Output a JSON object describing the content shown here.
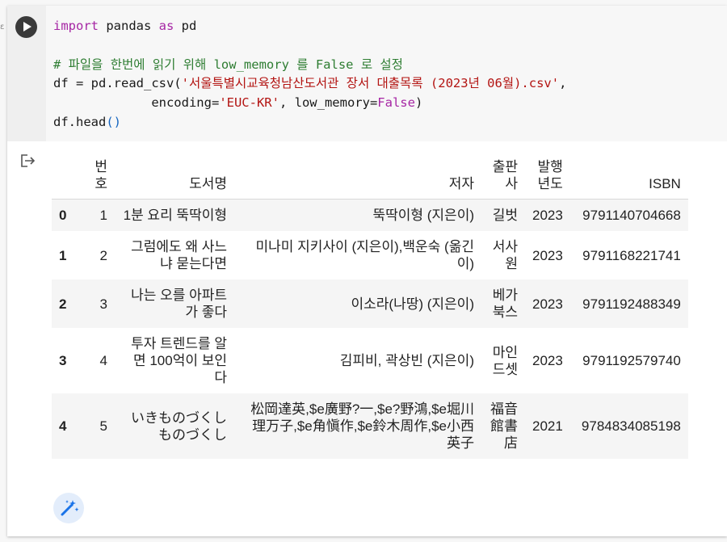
{
  "code": {
    "line1": [
      "import",
      " pandas ",
      "as",
      " pd"
    ],
    "line2_comment": "# 파일을 한번에 읽기 위해 low_memory 를 False 로 설정",
    "line3": [
      "df = pd.read_csv(",
      "'서울특별시교육청남산도서관 장서 대출목록 (2023년 06월).csv'",
      ","
    ],
    "line4": [
      "             encoding=",
      "'EUC-KR'",
      ", low_memory=",
      "False",
      ")"
    ],
    "line5": [
      "df.head",
      "()"
    ]
  },
  "output": {
    "columns": [
      "",
      "번호",
      "도서명",
      "저자",
      "출판사",
      "발행년도",
      "ISBN"
    ],
    "rows": [
      {
        "idx": "0",
        "no": "1",
        "title": "1분 요리 뚝딱이형",
        "author": "뚝딱이형 (지은이)",
        "publisher": "길벗",
        "year": "2023",
        "isbn": "9791140704668"
      },
      {
        "idx": "1",
        "no": "2",
        "title": "그럼에도 왜 사느냐 묻는다면",
        "author": "미나미 지키사이 (지은이),백운숙 (옮긴이)",
        "publisher": "서사원",
        "year": "2023",
        "isbn": "9791168221741"
      },
      {
        "idx": "2",
        "no": "3",
        "title": "나는 오를 아파트가 좋다",
        "author": "이소라(나땅) (지은이)",
        "publisher": "베가북스",
        "year": "2023",
        "isbn": "9791192488349"
      },
      {
        "idx": "3",
        "no": "4",
        "title": "투자 트렌드를 알면 100억이 보인다",
        "author": "김피비, 곽상빈 (지은이)",
        "publisher": "마인드셋",
        "year": "2023",
        "isbn": "9791192579740"
      },
      {
        "idx": "4",
        "no": "5",
        "title": "いきものづくし ものづくし",
        "author": "松岡達英,$e廣野?一,$e?野鴻,$e堀川理万子,$e角愼作,$e鈴木周作,$e小西英子",
        "publisher": "福音館書店",
        "year": "2021",
        "isbn": "9784834085198"
      }
    ]
  },
  "icons": {
    "run": "play-icon",
    "output": "output-icon",
    "magic": "magic-wand-icon"
  },
  "colors": {
    "keyword": "#a626a4",
    "comment": "#2e7d32",
    "string": "#b31412",
    "builtin": "#1565c0"
  }
}
